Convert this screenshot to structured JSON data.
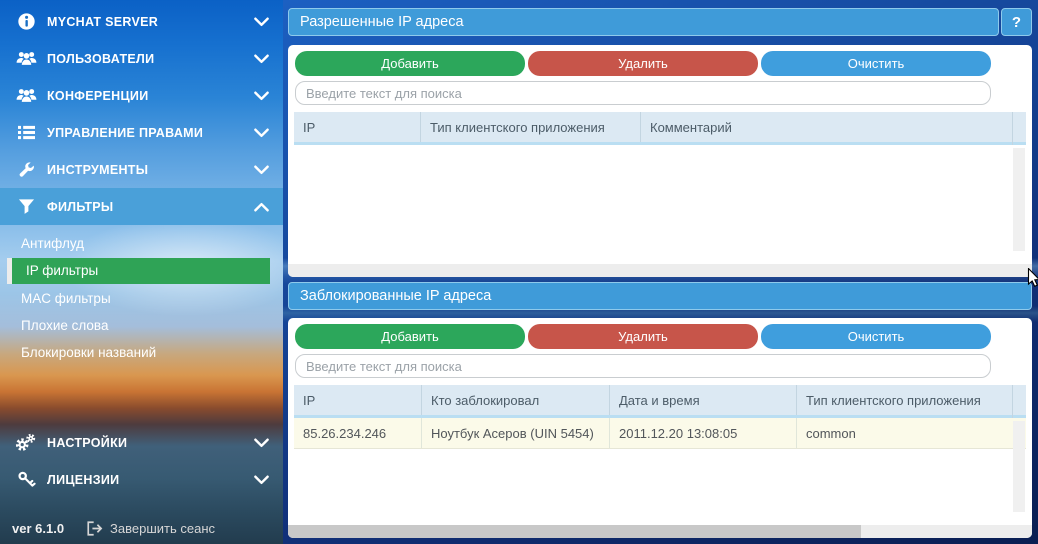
{
  "sidebar": {
    "items": [
      {
        "label": "MYCHAT SERVER"
      },
      {
        "label": "ПОЛЬЗОВАТЕЛИ"
      },
      {
        "label": "КОНФЕРЕНЦИИ"
      },
      {
        "label": "УПРАВЛЕНИЕ ПРАВАМИ"
      },
      {
        "label": "ИНСТРУМЕНТЫ"
      },
      {
        "label": "ФИЛЬТРЫ"
      },
      {
        "label": "НАСТРОЙКИ"
      },
      {
        "label": "ЛИЦЕНЗИИ"
      }
    ],
    "filters_submenu": {
      "items": [
        {
          "label": "Антифлуд"
        },
        {
          "label": "IP фильтры",
          "selected": true
        },
        {
          "label": "MAC фильтры"
        },
        {
          "label": "Плохие слова"
        },
        {
          "label": "Блокировки названий"
        }
      ]
    },
    "footer": {
      "version": "ver 6.1.0",
      "logout_label": "Завершить сеанс"
    }
  },
  "allowed_panel": {
    "title": "Разрешенные IP адреса",
    "help_label": "?",
    "buttons": {
      "add": "Добавить",
      "remove": "Удалить",
      "clear": "Очистить"
    },
    "search_placeholder": "Введите текст для поиска",
    "columns": [
      "IP",
      "Тип клиентского приложения",
      "Комментарий"
    ],
    "rows": []
  },
  "blocked_panel": {
    "title": "Заблокированные IP адреса",
    "buttons": {
      "add": "Добавить",
      "remove": "Удалить",
      "clear": "Очистить"
    },
    "search_placeholder": "Введите текст для поиска",
    "columns": [
      "IP",
      "Кто заблокировал",
      "Дата и время",
      "Тип клиентского приложения"
    ],
    "rows": [
      {
        "ip": "85.26.234.246",
        "blocked_by": "Ноутбук Асеров (UIN 5454)",
        "datetime": "2011.12.20 13:08:05",
        "client_type": "common"
      }
    ]
  },
  "colors": {
    "accent_green": "#2ca75b",
    "accent_red": "#c7554a",
    "accent_blue": "#3f9edd",
    "panel_header_blue": "#3f9bd9",
    "sidebar_active_blue": "#4aa0d9",
    "selected_item_green": "#2fa356",
    "row_highlight_yellow": "#fbfae9"
  }
}
